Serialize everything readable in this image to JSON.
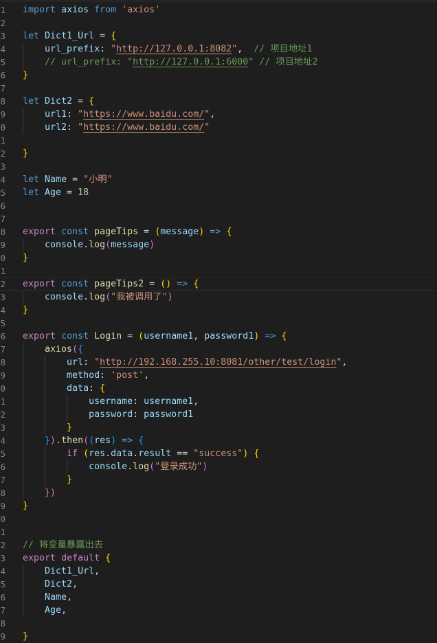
{
  "editor": {
    "language": "javascript",
    "lines": [
      {
        "n": "1",
        "tokens": [
          [
            "kw",
            "import"
          ],
          [
            "pn",
            " "
          ],
          [
            "var",
            "axios"
          ],
          [
            "pn",
            " "
          ],
          [
            "kw",
            "from"
          ],
          [
            "pn",
            " "
          ],
          [
            "str",
            "'axios'"
          ]
        ]
      },
      {
        "n": "2",
        "tokens": []
      },
      {
        "n": "3",
        "tokens": [
          [
            "kw",
            "let"
          ],
          [
            "pn",
            " "
          ],
          [
            "var",
            "Dict1_Url"
          ],
          [
            "pn",
            " = "
          ],
          [
            "b1",
            "{"
          ]
        ]
      },
      {
        "n": "4",
        "tokens": [
          [
            "pn",
            "    "
          ],
          [
            "var",
            "url_prefix"
          ],
          [
            "pn",
            ": "
          ],
          [
            "str",
            "\""
          ],
          [
            "str url",
            "http://127.0.0.1:8082"
          ],
          [
            "str",
            "\""
          ],
          [
            "pn",
            ",  "
          ],
          [
            "cmt",
            "// 项目地址1"
          ]
        ]
      },
      {
        "n": "5",
        "tokens": [
          [
            "pn",
            "    "
          ],
          [
            "cmt",
            "// url_prefix: \""
          ],
          [
            "cmt url",
            "http://127.0.0.1:6000"
          ],
          [
            "cmt",
            "\" // 项目地址2"
          ]
        ]
      },
      {
        "n": "6",
        "tokens": [
          [
            "b1",
            "}"
          ]
        ]
      },
      {
        "n": "7",
        "tokens": []
      },
      {
        "n": "8",
        "tokens": [
          [
            "kw",
            "let"
          ],
          [
            "pn",
            " "
          ],
          [
            "var",
            "Dict2"
          ],
          [
            "pn",
            " = "
          ],
          [
            "b1",
            "{"
          ]
        ]
      },
      {
        "n": "9",
        "tokens": [
          [
            "pn",
            "    "
          ],
          [
            "var",
            "url1"
          ],
          [
            "pn",
            ": "
          ],
          [
            "str",
            "\""
          ],
          [
            "str url",
            "https://www.baidu.com/"
          ],
          [
            "str",
            "\""
          ],
          [
            "pn",
            ","
          ]
        ]
      },
      {
        "n": "0",
        "tokens": [
          [
            "pn",
            "    "
          ],
          [
            "var",
            "url2"
          ],
          [
            "pn",
            ": "
          ],
          [
            "str",
            "\""
          ],
          [
            "str url",
            "https://www.baidu.com/"
          ],
          [
            "str",
            "\""
          ]
        ]
      },
      {
        "n": "1",
        "tokens": []
      },
      {
        "n": "2",
        "tokens": [
          [
            "b1",
            "}"
          ]
        ]
      },
      {
        "n": "3",
        "tokens": []
      },
      {
        "n": "4",
        "tokens": [
          [
            "kw",
            "let"
          ],
          [
            "pn",
            " "
          ],
          [
            "var",
            "Name"
          ],
          [
            "pn",
            " = "
          ],
          [
            "str",
            "\"小明\""
          ]
        ]
      },
      {
        "n": "5",
        "tokens": [
          [
            "kw",
            "let"
          ],
          [
            "pn",
            " "
          ],
          [
            "var",
            "Age"
          ],
          [
            "pn",
            " = "
          ],
          [
            "num",
            "18"
          ]
        ]
      },
      {
        "n": "6",
        "tokens": []
      },
      {
        "n": "7",
        "tokens": []
      },
      {
        "n": "8",
        "tokens": [
          [
            "ctl",
            "export"
          ],
          [
            "pn",
            " "
          ],
          [
            "kw",
            "const"
          ],
          [
            "pn",
            " "
          ],
          [
            "fn",
            "pageTips"
          ],
          [
            "pn",
            " = "
          ],
          [
            "b1",
            "("
          ],
          [
            "var",
            "message"
          ],
          [
            "b1",
            ")"
          ],
          [
            "pn",
            " "
          ],
          [
            "kw",
            "=>"
          ],
          [
            "pn",
            " "
          ],
          [
            "b1",
            "{"
          ]
        ]
      },
      {
        "n": "9",
        "tokens": [
          [
            "pn",
            "    "
          ],
          [
            "var",
            "console"
          ],
          [
            "pn",
            "."
          ],
          [
            "fn",
            "log"
          ],
          [
            "b2",
            "("
          ],
          [
            "var",
            "message"
          ],
          [
            "b2",
            ")"
          ]
        ]
      },
      {
        "n": "0",
        "tokens": [
          [
            "b1",
            "}"
          ]
        ]
      },
      {
        "n": "1",
        "tokens": []
      },
      {
        "n": "2",
        "tokens": [
          [
            "ctl",
            "export"
          ],
          [
            "pn",
            " "
          ],
          [
            "kw",
            "const"
          ],
          [
            "pn",
            " "
          ],
          [
            "fn",
            "pageTips2"
          ],
          [
            "pn",
            " = "
          ],
          [
            "b1",
            "()"
          ],
          [
            "pn",
            " "
          ],
          [
            "kw",
            "=>"
          ],
          [
            "pn",
            " "
          ],
          [
            "b1",
            "{"
          ]
        ],
        "current": true
      },
      {
        "n": "3",
        "tokens": [
          [
            "pn",
            "    "
          ],
          [
            "var",
            "console"
          ],
          [
            "pn",
            "."
          ],
          [
            "fn",
            "log"
          ],
          [
            "b2",
            "("
          ],
          [
            "str",
            "\"我被调用了\""
          ],
          [
            "b2",
            ")"
          ]
        ]
      },
      {
        "n": "4",
        "tokens": [
          [
            "b1",
            "}"
          ]
        ]
      },
      {
        "n": "5",
        "tokens": []
      },
      {
        "n": "6",
        "tokens": [
          [
            "ctl",
            "export"
          ],
          [
            "pn",
            " "
          ],
          [
            "kw",
            "const"
          ],
          [
            "pn",
            " "
          ],
          [
            "fn",
            "Login"
          ],
          [
            "pn",
            " = "
          ],
          [
            "b1",
            "("
          ],
          [
            "var",
            "username1"
          ],
          [
            "pn",
            ", "
          ],
          [
            "var",
            "password1"
          ],
          [
            "b1",
            ")"
          ],
          [
            "pn",
            " "
          ],
          [
            "kw",
            "=>"
          ],
          [
            "pn",
            " "
          ],
          [
            "b1",
            "{"
          ]
        ]
      },
      {
        "n": "7",
        "tokens": [
          [
            "pn",
            "    "
          ],
          [
            "fn",
            "axios"
          ],
          [
            "b2",
            "("
          ],
          [
            "b3",
            "{"
          ]
        ]
      },
      {
        "n": "8",
        "tokens": [
          [
            "pn",
            "        "
          ],
          [
            "var",
            "url"
          ],
          [
            "pn",
            ": "
          ],
          [
            "str",
            "\""
          ],
          [
            "str url",
            "http://192.168.255.10:8081/other/test/login"
          ],
          [
            "str",
            "\""
          ],
          [
            "pn",
            ","
          ]
        ]
      },
      {
        "n": "9",
        "tokens": [
          [
            "pn",
            "        "
          ],
          [
            "var",
            "method"
          ],
          [
            "pn",
            ": "
          ],
          [
            "str",
            "'post'"
          ],
          [
            "pn",
            ","
          ]
        ]
      },
      {
        "n": "0",
        "tokens": [
          [
            "pn",
            "        "
          ],
          [
            "var",
            "data"
          ],
          [
            "pn",
            ": "
          ],
          [
            "b1",
            "{"
          ]
        ]
      },
      {
        "n": "1",
        "tokens": [
          [
            "pn",
            "            "
          ],
          [
            "var",
            "username"
          ],
          [
            "pn",
            ": "
          ],
          [
            "var",
            "username1"
          ],
          [
            "pn",
            ","
          ]
        ]
      },
      {
        "n": "2",
        "tokens": [
          [
            "pn",
            "            "
          ],
          [
            "var",
            "password"
          ],
          [
            "pn",
            ": "
          ],
          [
            "var",
            "password1"
          ]
        ]
      },
      {
        "n": "3",
        "tokens": [
          [
            "pn",
            "        "
          ],
          [
            "b1",
            "}"
          ]
        ]
      },
      {
        "n": "4",
        "tokens": [
          [
            "pn",
            "    "
          ],
          [
            "b3",
            "}"
          ],
          [
            "b2",
            ")"
          ],
          [
            "pn",
            "."
          ],
          [
            "fn",
            "then"
          ],
          [
            "b2",
            "("
          ],
          [
            "b3",
            "("
          ],
          [
            "var",
            "res"
          ],
          [
            "b3",
            ")"
          ],
          [
            "pn",
            " "
          ],
          [
            "kw",
            "=>"
          ],
          [
            "pn",
            " "
          ],
          [
            "b3",
            "{"
          ]
        ]
      },
      {
        "n": "5",
        "tokens": [
          [
            "pn",
            "        "
          ],
          [
            "ctl",
            "if"
          ],
          [
            "pn",
            " "
          ],
          [
            "b1",
            "("
          ],
          [
            "var",
            "res"
          ],
          [
            "pn",
            "."
          ],
          [
            "var",
            "data"
          ],
          [
            "pn",
            "."
          ],
          [
            "var",
            "result"
          ],
          [
            "pn",
            " == "
          ],
          [
            "str",
            "\"success\""
          ],
          [
            "b1",
            ")"
          ],
          [
            "pn",
            " "
          ],
          [
            "b1",
            "{"
          ]
        ]
      },
      {
        "n": "6",
        "tokens": [
          [
            "pn",
            "            "
          ],
          [
            "var",
            "console"
          ],
          [
            "pn",
            "."
          ],
          [
            "fn",
            "log"
          ],
          [
            "b2",
            "("
          ],
          [
            "str",
            "\"登录成功\""
          ],
          [
            "b2",
            ")"
          ]
        ]
      },
      {
        "n": "7",
        "tokens": [
          [
            "pn",
            "        "
          ],
          [
            "b1",
            "}"
          ]
        ]
      },
      {
        "n": "8",
        "tokens": [
          [
            "pn",
            "    "
          ],
          [
            "b2",
            "})"
          ]
        ]
      },
      {
        "n": "9",
        "tokens": [
          [
            "b1",
            "}"
          ]
        ]
      },
      {
        "n": "0",
        "tokens": []
      },
      {
        "n": "1",
        "tokens": []
      },
      {
        "n": "2",
        "tokens": [
          [
            "cmt",
            "// 将变量暴露出去"
          ]
        ]
      },
      {
        "n": "3",
        "tokens": [
          [
            "ctl",
            "export"
          ],
          [
            "pn",
            " "
          ],
          [
            "ctl",
            "default"
          ],
          [
            "pn",
            " "
          ],
          [
            "b1",
            "{"
          ]
        ]
      },
      {
        "n": "4",
        "tokens": [
          [
            "pn",
            "    "
          ],
          [
            "var",
            "Dict1_Url"
          ],
          [
            "pn",
            ","
          ]
        ]
      },
      {
        "n": "5",
        "tokens": [
          [
            "pn",
            "    "
          ],
          [
            "var",
            "Dict2"
          ],
          [
            "pn",
            ","
          ]
        ]
      },
      {
        "n": "6",
        "tokens": [
          [
            "pn",
            "    "
          ],
          [
            "var",
            "Name"
          ],
          [
            "pn",
            ","
          ]
        ]
      },
      {
        "n": "7",
        "tokens": [
          [
            "pn",
            "    "
          ],
          [
            "var",
            "Age"
          ],
          [
            "pn",
            ","
          ]
        ]
      },
      {
        "n": "8",
        "tokens": []
      },
      {
        "n": "9",
        "tokens": [
          [
            "b1",
            "}"
          ]
        ]
      }
    ]
  }
}
